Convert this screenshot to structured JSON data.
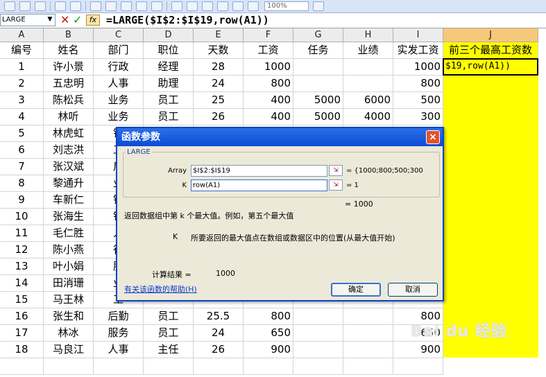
{
  "toolbar": {
    "zoom": "100%"
  },
  "formula_bar": {
    "name_box": "LARGE",
    "formula": "=LARGE($I$2:$I$19,row(A1))"
  },
  "columns": [
    "A",
    "B",
    "C",
    "D",
    "E",
    "F",
    "G",
    "H",
    "I",
    "J"
  ],
  "header_row": [
    "编号",
    "姓名",
    "部门",
    "职位",
    "天数",
    "工资",
    "任务",
    "业绩",
    "实发工资",
    "前三个最高工资数"
  ],
  "rows": [
    {
      "n": "1",
      "name": "许小景",
      "dept": "行政",
      "pos": "经理",
      "days": "28",
      "wage": "1000",
      "task": "",
      "perf": "",
      "pay": "1000"
    },
    {
      "n": "2",
      "name": "五忠明",
      "dept": "人事",
      "pos": "助理",
      "days": "24",
      "wage": "800",
      "task": "",
      "perf": "",
      "pay": "800"
    },
    {
      "n": "3",
      "name": "陈松兵",
      "dept": "业务",
      "pos": "员工",
      "days": "25",
      "wage": "400",
      "task": "5000",
      "perf": "6000",
      "pay": "500"
    },
    {
      "n": "4",
      "name": "林听",
      "dept": "业务",
      "pos": "员工",
      "days": "26",
      "wage": "400",
      "task": "5000",
      "perf": "4000",
      "pay": "300"
    },
    {
      "n": "5",
      "name": "林虎虹",
      "dept": "销",
      "pos": "",
      "days": "",
      "wage": "",
      "task": "",
      "perf": "",
      "pay": ""
    },
    {
      "n": "6",
      "name": "刘志洪",
      "dept": "工",
      "pos": "",
      "days": "",
      "wage": "",
      "task": "",
      "perf": "",
      "pay": ""
    },
    {
      "n": "7",
      "name": "张汉斌",
      "dept": "后",
      "pos": "",
      "days": "",
      "wage": "",
      "task": "",
      "perf": "",
      "pay": ""
    },
    {
      "n": "8",
      "name": "黎通升",
      "dept": "业",
      "pos": "",
      "days": "",
      "wage": "",
      "task": "",
      "perf": "",
      "pay": ""
    },
    {
      "n": "9",
      "name": "车新仁",
      "dept": "销",
      "pos": "",
      "days": "",
      "wage": "",
      "task": "",
      "perf": "",
      "pay": ""
    },
    {
      "n": "10",
      "name": "张海生",
      "dept": "销",
      "pos": "",
      "days": "",
      "wage": "",
      "task": "",
      "perf": "",
      "pay": ""
    },
    {
      "n": "11",
      "name": "毛仁胜",
      "dept": "人",
      "pos": "",
      "days": "",
      "wage": "",
      "task": "",
      "perf": "",
      "pay": ""
    },
    {
      "n": "12",
      "name": "陈小燕",
      "dept": "行",
      "pos": "",
      "days": "",
      "wage": "",
      "task": "",
      "perf": "",
      "pay": ""
    },
    {
      "n": "13",
      "name": "叶小娟",
      "dept": "服",
      "pos": "",
      "days": "",
      "wage": "",
      "task": "",
      "perf": "",
      "pay": ""
    },
    {
      "n": "14",
      "name": "田消珊",
      "dept": "业",
      "pos": "",
      "days": "",
      "wage": "",
      "task": "",
      "perf": "",
      "pay": ""
    },
    {
      "n": "15",
      "name": "马王林",
      "dept": "工",
      "pos": "",
      "days": "",
      "wage": "",
      "task": "",
      "perf": "",
      "pay": ""
    },
    {
      "n": "16",
      "name": "张生和",
      "dept": "后勤",
      "pos": "员工",
      "days": "25.5",
      "wage": "800",
      "task": "",
      "perf": "",
      "pay": "800"
    },
    {
      "n": "17",
      "name": "林冰",
      "dept": "服务",
      "pos": "员工",
      "days": "24",
      "wage": "650",
      "task": "",
      "perf": "",
      "pay": "650"
    },
    {
      "n": "18",
      "name": "马良江",
      "dept": "人事",
      "pos": "主任",
      "days": "26",
      "wage": "900",
      "task": "",
      "perf": "",
      "pay": "900"
    }
  ],
  "j1_text": "$19,row(A1))",
  "dialog": {
    "title": "函数参数",
    "close": "×",
    "group_label": "LARGE",
    "args": [
      {
        "label": "Array",
        "value": "$I$2:$I$19",
        "result": "= {1000;800;500;300"
      },
      {
        "label": "K",
        "value": "row(A1)",
        "result": "= 1"
      }
    ],
    "overall_result": "= 1000",
    "description": "返回数据组中第 k 个最大值。例如，第五个最大值",
    "arg_name": "K",
    "arg_description": "所要返回的最大值点在数组或数据区中的位置(从最大值开始)",
    "calc_label": "计算结果 =",
    "calc_value": "1000",
    "help_link": "有关该函数的帮助(H)",
    "ok": "确定",
    "cancel": "取消"
  },
  "watermark": "Bai du 经验"
}
